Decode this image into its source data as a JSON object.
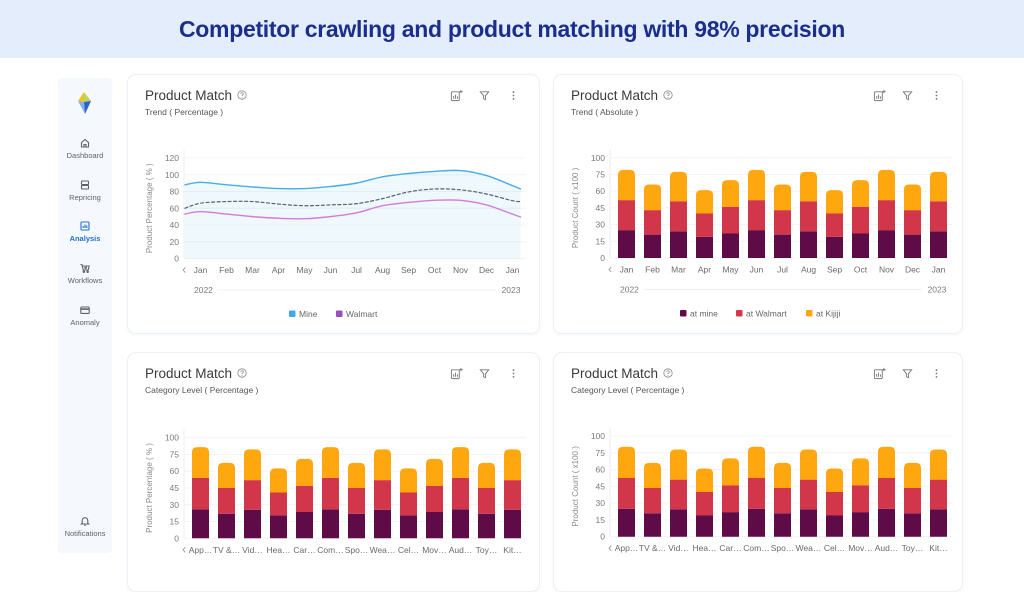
{
  "banner": {
    "title": "Competitor crawling and product matching with 98% precision"
  },
  "colors": {
    "banner_bg": "#e3edfb",
    "banner_text": "#1a2e8c",
    "sidebar_bg": "#f5f8fd",
    "active_nav": "#1e6fd9"
  },
  "sidebar": {
    "logo": "gem-logo-icon",
    "items": [
      {
        "label": "Dashboard",
        "icon": "home-icon",
        "active": false
      },
      {
        "label": "Repricing",
        "icon": "repricing-icon",
        "active": false
      },
      {
        "label": "Analysis",
        "icon": "analysis-icon",
        "active": true
      },
      {
        "label": "Workflows",
        "icon": "cart-icon",
        "active": false
      },
      {
        "label": "Anomaly",
        "icon": "credit-card-icon",
        "active": false
      }
    ],
    "footer": {
      "label": "Notifications",
      "icon": "bell-icon"
    }
  },
  "cards": [
    {
      "title": "Product Match",
      "subtitle": "Trend ( Percentage )",
      "toolbar": [
        "chart-settings-icon",
        "filter-icon",
        "more-vertical-icon"
      ]
    },
    {
      "title": "Product Match",
      "subtitle": "Trend ( Absolute )",
      "toolbar": [
        "chart-settings-icon",
        "filter-icon",
        "more-vertical-icon"
      ]
    },
    {
      "title": "Product Match",
      "subtitle": "Category Level ( Percentage )",
      "toolbar": [
        "chart-settings-icon",
        "filter-icon",
        "more-vertical-icon"
      ]
    },
    {
      "title": "Product Match",
      "subtitle": "Category Level ( Percentage )",
      "toolbar": [
        "chart-settings-icon",
        "filter-icon",
        "more-vertical-icon"
      ]
    }
  ],
  "chart_data": [
    {
      "type": "line",
      "title": "Product Match",
      "subtitle": "Trend ( Percentage )",
      "xlabel": "",
      "ylabel": "Product Percentage ( % )",
      "yticks": [
        0,
        20,
        40,
        60,
        80,
        100,
        120
      ],
      "ylim": [
        0,
        120
      ],
      "categories": [
        "Jan",
        "Feb",
        "Mar",
        "Apr",
        "May",
        "Jun",
        "Jul",
        "Aug",
        "Sep",
        "Oct",
        "Nov",
        "Dec",
        "Jan"
      ],
      "year_labels": [
        "2022",
        "2023"
      ],
      "grid": true,
      "legend": "bottom-center",
      "series": [
        {
          "name": "Mine",
          "color": "#47ade6",
          "legend_color": "#3fa9ea",
          "style": "solid",
          "area": true,
          "in_legend": true,
          "values": [
            91,
            88,
            85.5,
            83.5,
            83.5,
            86,
            90,
            97.5,
            101.5,
            104,
            105,
            99,
            87
          ],
          "edge_values": [
            88,
            83
          ]
        },
        {
          "name": "Walmart",
          "color": "#d47bd9",
          "legend_color": "#9b4fb8",
          "style": "solid",
          "in_legend": true,
          "values": [
            56,
            53,
            50,
            48,
            47.5,
            50,
            54.5,
            63,
            67,
            69.5,
            69.5,
            64,
            53
          ],
          "edge_values": [
            53,
            49.5
          ]
        },
        {
          "name": "",
          "color": "#5b5f70",
          "style": "dashed",
          "in_legend": false,
          "values": [
            66,
            68,
            68,
            65,
            63,
            64,
            65.5,
            71.5,
            79.5,
            83,
            82,
            77,
            69
          ],
          "edge_values": [
            60,
            68
          ]
        }
      ]
    },
    {
      "type": "bar",
      "stacked": true,
      "title": "Product Match",
      "subtitle": "Trend ( Absolute )",
      "xlabel": "",
      "ylabel": "Product Count ( x100 )",
      "yticks": [
        0,
        15,
        30,
        45,
        60,
        75,
        100
      ],
      "ylim": [
        0,
        100
      ],
      "categories": [
        "Jan",
        "Feb",
        "Mar",
        "Apr",
        "May",
        "Jun",
        "Jul",
        "Aug",
        "Sep",
        "Oct",
        "Nov",
        "Dec",
        "Jan"
      ],
      "year_labels": [
        "2022",
        "2023"
      ],
      "grid": true,
      "legend": "bottom-center",
      "series": [
        {
          "name": "at mine",
          "color": "#5e0b47",
          "in_legend": true,
          "values": [
            25,
            21,
            24,
            19,
            22,
            25,
            21,
            24,
            19,
            22,
            25,
            21,
            24
          ]
        },
        {
          "name": "at Walmart",
          "color": "#d1364a",
          "in_legend": true,
          "values": [
            27,
            22,
            27,
            21,
            24,
            27,
            22,
            27,
            21,
            24,
            27,
            22,
            27
          ]
        },
        {
          "name": "at Kijiji",
          "color": "#ffa70f",
          "in_legend": true,
          "values": [
            30,
            23,
            28,
            21,
            24,
            30,
            23,
            28,
            21,
            24,
            30,
            23,
            28
          ]
        }
      ]
    },
    {
      "type": "bar",
      "stacked": true,
      "title": "Product Match",
      "subtitle": "Category Level ( Percentage )",
      "xlabel": "",
      "ylabel": "Product Percentage ( % )",
      "yticks": [
        0,
        15,
        30,
        45,
        60,
        75,
        100
      ],
      "ylim": [
        0,
        100
      ],
      "categories": [
        "App…",
        "TV &…",
        "Vid…",
        "Hea…",
        "Car…",
        "Com…",
        "Spo…",
        "Wea…",
        "Cel…",
        "Mov…",
        "Aud…",
        "Toy…",
        "Kit…"
      ],
      "grid": true,
      "legend": "not visible",
      "series": [
        {
          "name": "at mine",
          "color": "#5e0b47",
          "values": [
            26,
            22,
            25.5,
            20.5,
            23.5,
            26,
            22,
            25.5,
            20.5,
            23.5,
            26,
            22,
            25.5
          ]
        },
        {
          "name": "at Walmart",
          "color": "#d1364a",
          "values": [
            28,
            23,
            26.5,
            20.5,
            23.5,
            28,
            23,
            26.5,
            20.5,
            23.5,
            28,
            23,
            26.5
          ]
        },
        {
          "name": "at Kijiji",
          "color": "#ffa70f",
          "values": [
            32,
            22.5,
            30.5,
            21.5,
            24,
            32,
            22.5,
            30.5,
            21.5,
            24,
            32,
            22.5,
            30.5
          ]
        }
      ]
    },
    {
      "type": "bar",
      "stacked": true,
      "title": "Product Match",
      "subtitle": "Category Level ( Percentage )",
      "xlabel": "",
      "ylabel": "Product Count ( x100 )",
      "yticks": [
        0,
        15,
        30,
        45,
        60,
        75,
        100
      ],
      "ylim": [
        0,
        100
      ],
      "categories": [
        "App…",
        "TV &…",
        "Vid…",
        "Hea…",
        "Car…",
        "Com…",
        "Spo…",
        "Wea…",
        "Cel…",
        "Mov…",
        "Aud…",
        "Toy…",
        "Kit…"
      ],
      "grid": true,
      "legend": "not visible",
      "series": [
        {
          "name": "at mine",
          "color": "#5e0b47",
          "values": [
            25,
            21,
            24.5,
            19,
            22,
            25,
            21,
            24.5,
            19,
            22,
            25,
            21,
            24.5
          ]
        },
        {
          "name": "at Walmart",
          "color": "#d1364a",
          "values": [
            27.5,
            22.5,
            26.5,
            21,
            24,
            27.5,
            22.5,
            26.5,
            21,
            24,
            27.5,
            22.5,
            26.5
          ]
        },
        {
          "name": "at Kijiji",
          "color": "#ffa70f",
          "values": [
            31.5,
            22.5,
            29,
            21,
            24,
            31.5,
            22.5,
            29,
            21,
            24,
            31.5,
            22.5,
            29
          ]
        }
      ]
    }
  ]
}
